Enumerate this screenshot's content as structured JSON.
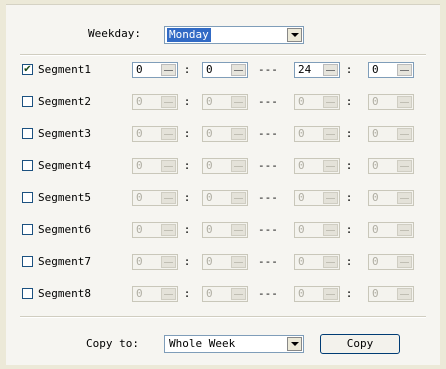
{
  "weekday": {
    "label": "Weekday:",
    "value": "Monday"
  },
  "time_separator": ":",
  "range_separator": "---",
  "segments": [
    {
      "label": "Segment1",
      "checked": true,
      "start_hour": "0",
      "start_min": "0",
      "end_hour": "24",
      "end_min": "0"
    },
    {
      "label": "Segment2",
      "checked": false,
      "start_hour": "0",
      "start_min": "0",
      "end_hour": "0",
      "end_min": "0"
    },
    {
      "label": "Segment3",
      "checked": false,
      "start_hour": "0",
      "start_min": "0",
      "end_hour": "0",
      "end_min": "0"
    },
    {
      "label": "Segment4",
      "checked": false,
      "start_hour": "0",
      "start_min": "0",
      "end_hour": "0",
      "end_min": "0"
    },
    {
      "label": "Segment5",
      "checked": false,
      "start_hour": "0",
      "start_min": "0",
      "end_hour": "0",
      "end_min": "0"
    },
    {
      "label": "Segment6",
      "checked": false,
      "start_hour": "0",
      "start_min": "0",
      "end_hour": "0",
      "end_min": "0"
    },
    {
      "label": "Segment7",
      "checked": false,
      "start_hour": "0",
      "start_min": "0",
      "end_hour": "0",
      "end_min": "0"
    },
    {
      "label": "Segment8",
      "checked": false,
      "start_hour": "0",
      "start_min": "0",
      "end_hour": "0",
      "end_min": "0"
    }
  ],
  "copy": {
    "label": "Copy to:",
    "value": "Whole Week",
    "button_label": "Copy"
  }
}
